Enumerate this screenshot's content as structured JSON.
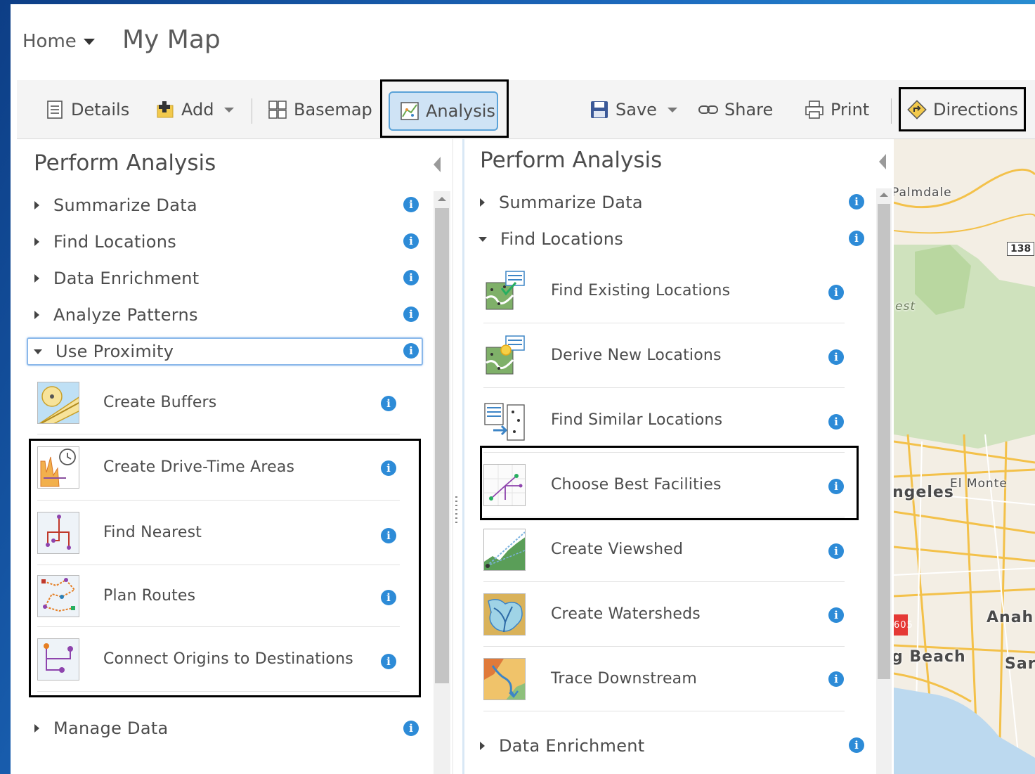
{
  "header": {
    "home_label": "Home",
    "map_title": "My Map"
  },
  "toolbar": {
    "details": "Details",
    "add": "Add",
    "basemap": "Basemap",
    "analysis": "Analysis",
    "save": "Save",
    "share": "Share",
    "print": "Print",
    "directions": "Directions"
  },
  "left_panel": {
    "title": "Perform Analysis",
    "categories": [
      {
        "label": "Summarize Data",
        "expanded": false
      },
      {
        "label": "Find Locations",
        "expanded": false
      },
      {
        "label": "Data Enrichment",
        "expanded": false
      },
      {
        "label": "Analyze Patterns",
        "expanded": false
      },
      {
        "label": "Use Proximity",
        "expanded": true
      },
      {
        "label": "Manage Data",
        "expanded": false
      }
    ],
    "tools": [
      {
        "label": "Create Buffers",
        "icon": "create-buffers-icon"
      },
      {
        "label": "Create Drive-Time Areas",
        "icon": "drive-time-areas-icon"
      },
      {
        "label": "Find Nearest",
        "icon": "find-nearest-icon"
      },
      {
        "label": "Plan Routes",
        "icon": "plan-routes-icon"
      },
      {
        "label": "Connect Origins to Destinations",
        "icon": "connect-origins-icon"
      }
    ]
  },
  "right_panel": {
    "title": "Perform Analysis",
    "categories": [
      {
        "label": "Summarize Data",
        "expanded": false
      },
      {
        "label": "Find Locations",
        "expanded": true
      },
      {
        "label": "Data Enrichment",
        "expanded": false
      }
    ],
    "tools": [
      {
        "label": "Find Existing Locations",
        "icon": "find-existing-locations-icon"
      },
      {
        "label": "Derive New Locations",
        "icon": "derive-new-locations-icon"
      },
      {
        "label": "Find Similar Locations",
        "icon": "find-similar-locations-icon"
      },
      {
        "label": "Choose Best Facilities",
        "icon": "choose-best-facilities-icon"
      },
      {
        "label": "Create Viewshed",
        "icon": "create-viewshed-icon"
      },
      {
        "label": "Create Watersheds",
        "icon": "create-watersheds-icon"
      },
      {
        "label": "Trace Downstream",
        "icon": "trace-downstream-icon"
      }
    ]
  },
  "map": {
    "labels": [
      "Palmdale",
      "138",
      "ngeles",
      "El Monte",
      "Anah",
      "g Beach",
      "Sar",
      "605"
    ],
    "partial_label": "est"
  },
  "colors": {
    "info_blue": "#2d8bd7",
    "analysis_active_bg": "#cfe3f5",
    "focus_outline": "#8ab8ea"
  }
}
